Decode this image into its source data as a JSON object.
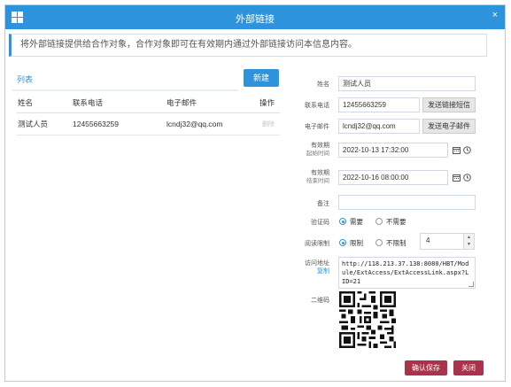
{
  "dialog": {
    "title": "外部链接",
    "close_glyph": "×",
    "notice": "将外部链接提供给合作对象，合作对象即可在有效期内通过外部链接访问本信息内容。"
  },
  "list": {
    "tab_label": "列表",
    "new_button": "新建",
    "columns": [
      "姓名",
      "联系电话",
      "电子邮件",
      "操作"
    ],
    "rows": [
      {
        "name": "测试人员",
        "phone": "12455663259",
        "email": "lcndj32@qq.com",
        "action": "删除"
      }
    ]
  },
  "form": {
    "name_label": "姓名",
    "name_value": "测试人员",
    "phone_label": "联系电话",
    "phone_value": "12455663259",
    "send_sms_button": "发送链接短信",
    "email_label": "电子邮件",
    "email_value": "lcndj32@qq.com",
    "send_email_button": "发送电子邮件",
    "start_label_1": "有效期",
    "start_label_2": "起始时间",
    "start_value": "2022-10-13 17:32:00",
    "end_label_1": "有效期",
    "end_label_2": "结束时间",
    "end_value": "2022-10-16 08:00:00",
    "remark_label": "备注",
    "remark_value": "",
    "captcha_label": "验证码",
    "captcha_options": [
      "需要",
      "不需要"
    ],
    "captcha_selected": "需要",
    "read_limit_label": "阅读限制",
    "read_limit_options": [
      "限制",
      "不限制"
    ],
    "read_limit_selected": "限制",
    "read_limit_count": "4",
    "url_label": "访问地址",
    "copy_label": "复制",
    "url_value": "http://118.213.37.138:8080/HBT/Module/ExtAccess/ExtAccessLink.aspx?LID=21",
    "qr_label": "二维码"
  },
  "footer": {
    "save_button": "确认保存",
    "close_button": "关闭"
  },
  "colors": {
    "title_bar": "#2e93dd",
    "primary": "#2e93dd",
    "footer_button": "#a8334b"
  }
}
